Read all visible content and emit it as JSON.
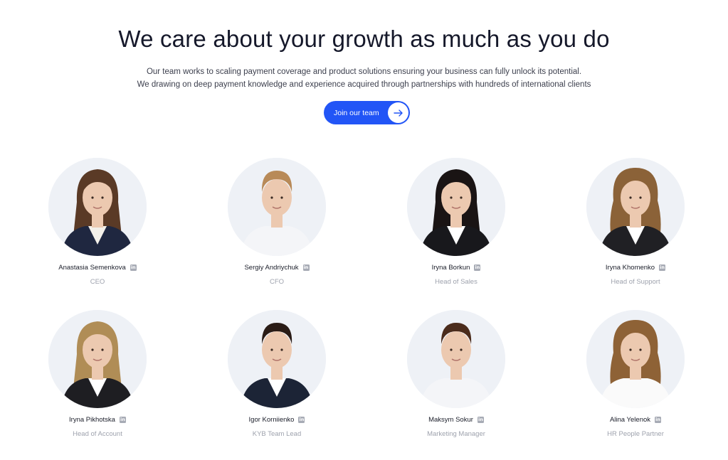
{
  "header": {
    "title": "We care about your growth as much as you do",
    "subtitle_line1": "Our team works to scaling payment coverage and product solutions ensuring your business can fully unlock its potential.",
    "subtitle_line2": "We drawing on deep payment knowledge and experience acquired through partnerships with hundreds of international clients",
    "cta_label": "Join our team"
  },
  "colors": {
    "accent": "#2255f6",
    "avatar_bg": "#eef1f6",
    "role_text": "#9ea2ad"
  },
  "team": [
    {
      "name": "Anastasia Semenkova",
      "role": "CEO",
      "hair": "#5a3a26",
      "suit": "#1f2740",
      "shirt": "#f3f0ea",
      "hair_style": "long"
    },
    {
      "name": "Sergiy Andriychuk",
      "role": "CFO",
      "hair": "#b88a58",
      "suit": "#f4f5f8",
      "shirt": "#f4f5f8",
      "hair_style": "short"
    },
    {
      "name": "Iryna Borkun",
      "role": "Head of Sales",
      "hair": "#1a1414",
      "suit": "#18181c",
      "shirt": "#ffffff",
      "hair_style": "long"
    },
    {
      "name": "Iryna Khomenko",
      "role": "Head of Support",
      "hair": "#8b6238",
      "suit": "#202024",
      "shirt": "#ffffff",
      "hair_style": "curly"
    },
    {
      "name": "Iryna Pikhotska",
      "role": "Head of Account",
      "hair": "#b08d56",
      "suit": "#1e1e22",
      "shirt": "#ffffff",
      "hair_style": "long"
    },
    {
      "name": "Igor Korniienko",
      "role": "KYB Team Lead",
      "hair": "#2a1c16",
      "suit": "#1c2436",
      "shirt": "#ffffff",
      "hair_style": "short"
    },
    {
      "name": "Maksym Sokur",
      "role": "Marketing Manager",
      "hair": "#4b2c1c",
      "suit": "#f4f5f8",
      "shirt": "#f4f5f8",
      "hair_style": "short"
    },
    {
      "name": "Alina Yelenok",
      "role": "HR People Partner",
      "hair": "#8e6236",
      "suit": "#fafafa",
      "shirt": "#fafafa",
      "hair_style": "curly"
    }
  ]
}
